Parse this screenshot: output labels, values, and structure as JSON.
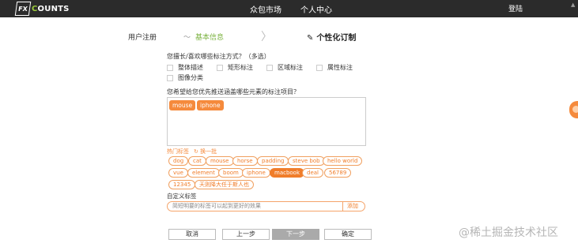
{
  "header": {
    "logo_mark": "FX",
    "logo_text_1": "C",
    "logo_text_2": "OUNTS",
    "nav": [
      "众包市场",
      "个人中心"
    ],
    "login": "登陆"
  },
  "steps": {
    "register": "用户注册",
    "basic": "基本信息",
    "basic_chevron": "〜",
    "arrow": "〉",
    "custom_icon": "✎",
    "custom": "个性化订制"
  },
  "q1": {
    "label": "您擅长/喜欢哪些标注方式？（多选）",
    "options": [
      "整体描述",
      "矩形标注",
      "区域标注",
      "属性标注",
      "图像分类"
    ]
  },
  "q2": {
    "label": "您希望给您优先推送涵盖哪些元素的标注项目？",
    "selected": [
      "mouse",
      "iphone"
    ]
  },
  "hot": {
    "label": "热门标签",
    "swap": "↻ 换一批",
    "tags": [
      "dog",
      "cat",
      "mouse",
      "horse",
      "padding",
      "steve bob",
      "hello world",
      "vue",
      "element",
      "boom",
      "iphone",
      "macbook",
      "deal",
      "56789",
      "12345",
      "天则降大任于斯人也"
    ]
  },
  "custom": {
    "label": "自定义标签",
    "placeholder": "简短明要的标签可以起到更好的效果",
    "add": "添加"
  },
  "buttons": {
    "cancel": "取消",
    "prev": "上一步",
    "next": "下一步",
    "confirm": "确定"
  },
  "watermark": "@稀土掘金技术社区",
  "colors": {
    "accent": "#f07d2a",
    "step_active_green": "#7cb342",
    "topbar": "#2b2b2b"
  }
}
